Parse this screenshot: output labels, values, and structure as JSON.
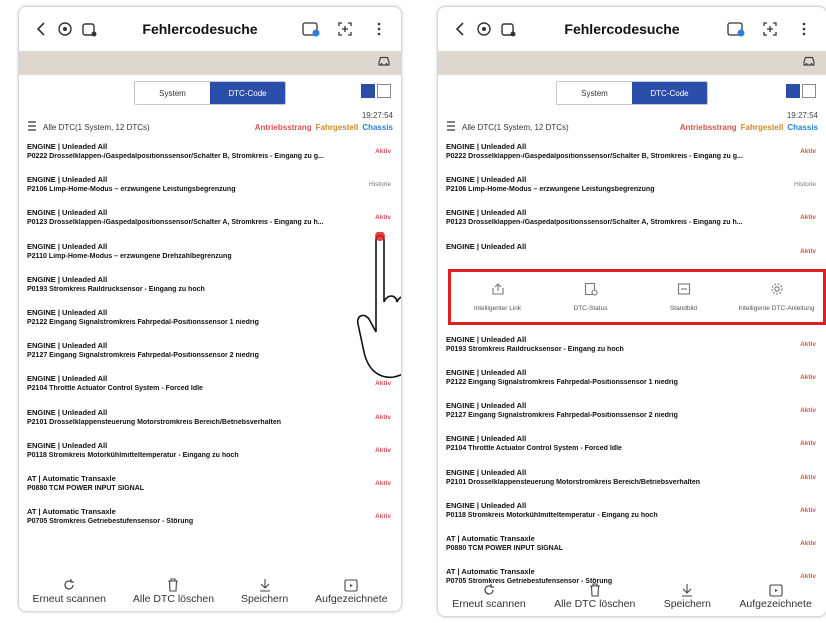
{
  "title": "Fehlercodesuche",
  "tabs": {
    "system": "System",
    "dtc": "DTC-Code"
  },
  "time": "19:27:54",
  "filter": {
    "all": "Alle DTC(1 System, 12 DTCs)",
    "powertrain": "Antriebsstrang",
    "chassis_tag": "Fahrgestell",
    "chassis": "Chassis"
  },
  "colors": {
    "active_tab": "#2b4fa8",
    "active_status": "#d9534f",
    "menu_border": "#e02020",
    "powertrain": "#d9534f",
    "chassis_tag": "#c98a2b",
    "chassis": "#2b7fd8"
  },
  "left_rows": [
    {
      "title": "ENGINE | Unleaded All",
      "desc": "P0222 Drosselklappen-/Gaspedalpositionssensor/Schalter B, Stromkreis - Eingang zu g...",
      "status": "Aktiv"
    },
    {
      "title": "ENGINE | Unleaded All",
      "desc": "P2106 Limp-Home-Modus – erzwungene Leistungsbegrenzung",
      "status": "Historie"
    },
    {
      "title": "ENGINE | Unleaded All",
      "desc": "P0123 Drosselklappen-/Gaspedalpositionssensor/Schalter A, Stromkreis - Eingang zu h...",
      "status": "Aktiv"
    },
    {
      "title": "ENGINE | Unleaded All",
      "desc": "P2110 Limp-Home-Modus – erzwungene Drehzahlbegrenzung",
      "status": ""
    },
    {
      "title": "ENGINE | Unleaded All",
      "desc": "P0193 Stromkreis Raildrucksensor - Eingang zu hoch",
      "status": ""
    },
    {
      "title": "ENGINE | Unleaded All",
      "desc": "P2122 Eingang Signalstromkreis Fahrpedal-Positionssensor 1 niedrig",
      "status": ""
    },
    {
      "title": "ENGINE | Unleaded All",
      "desc": "P2127 Eingang Signalstromkreis Fahrpedal-Positionssensor 2 niedrig",
      "status": ""
    },
    {
      "title": "ENGINE | Unleaded All",
      "desc": "P2104 Throttle Actuator Control System - Forced Idle",
      "status": "Aktiv"
    },
    {
      "title": "ENGINE | Unleaded All",
      "desc": "P2101 Drosselklappensteuerung Motorstromkreis Bereich/Betriebsverhalten",
      "status": "Aktiv"
    },
    {
      "title": "ENGINE | Unleaded All",
      "desc": "P0118 Stromkreis Motorkühlmitteltemperatur - Eingang zu hoch",
      "status": "Aktiv"
    },
    {
      "title": "AT | Automatic Transaxle",
      "desc": "P0880 TCM POWER INPUT SIGNAL",
      "status": "Aktiv"
    },
    {
      "title": "AT | Automatic Transaxle",
      "desc": "P0705 Stromkreis Getriebestufensensor - Störung",
      "status": "Aktiv"
    }
  ],
  "right_rows_top": [
    {
      "title": "ENGINE | Unleaded All",
      "desc": "P0222 Drosselklappen-/Gaspedalpositionssensor/Schalter B, Stromkreis - Eingang zu g...",
      "status": "Aktiv"
    },
    {
      "title": "ENGINE | Unleaded All",
      "desc": "P2106 Limp-Home-Modus – erzwungene Leistungsbegrenzung",
      "status": "Historie"
    },
    {
      "title": "ENGINE | Unleaded All",
      "desc": "P0123 Drosselklappen-/Gaspedalpositionssensor/Schalter A, Stromkreis - Eingang zu h...",
      "status": "Aktiv"
    },
    {
      "title": "ENGINE | Unleaded All",
      "desc": "",
      "status": "Aktiv"
    }
  ],
  "right_rows_bottom": [
    {
      "title": "ENGINE | Unleaded All",
      "desc": "P0193 Stromkreis Raildrucksensor - Eingang zu hoch",
      "status": "Aktiv"
    },
    {
      "title": "ENGINE | Unleaded All",
      "desc": "P2122 Eingang Signalstromkreis Fahrpedal-Positionssensor 1 niedrig",
      "status": "Aktiv"
    },
    {
      "title": "ENGINE | Unleaded All",
      "desc": "P2127 Eingang Signalstromkreis Fahrpedal-Positionssensor 2 niedrig",
      "status": "Aktiv"
    },
    {
      "title": "ENGINE | Unleaded All",
      "desc": "P2104 Throttle Actuator Control System - Forced Idle",
      "status": "Aktiv"
    },
    {
      "title": "ENGINE | Unleaded All",
      "desc": "P2101 Drosselklappensteuerung Motorstromkreis Bereich/Betriebsverhalten",
      "status": "Aktiv"
    },
    {
      "title": "ENGINE | Unleaded All",
      "desc": "P0118 Stromkreis Motorkühlmitteltemperatur - Eingang zu hoch",
      "status": "Aktiv"
    },
    {
      "title": "AT | Automatic Transaxle",
      "desc": "P0880 TCM POWER INPUT SIGNAL",
      "status": "Aktiv"
    },
    {
      "title": "AT | Automatic Transaxle",
      "desc": "P0705 Stromkreis Getriebestufensensor - Störung",
      "status": "Aktiv"
    }
  ],
  "context_menu": [
    {
      "label": "Intelligenter Link",
      "icon": "share-icon"
    },
    {
      "label": "DTC-Status",
      "icon": "status-icon"
    },
    {
      "label": "Standbild",
      "icon": "freeze-frame-icon"
    },
    {
      "label": "Intelligente DTC-Anleitung",
      "icon": "gear-icon"
    }
  ],
  "bottom": {
    "rescan": "Erneut scannen",
    "clear": "Alle DTC löschen",
    "save": "Speichern",
    "recorded": "Aufgezeichnete"
  }
}
